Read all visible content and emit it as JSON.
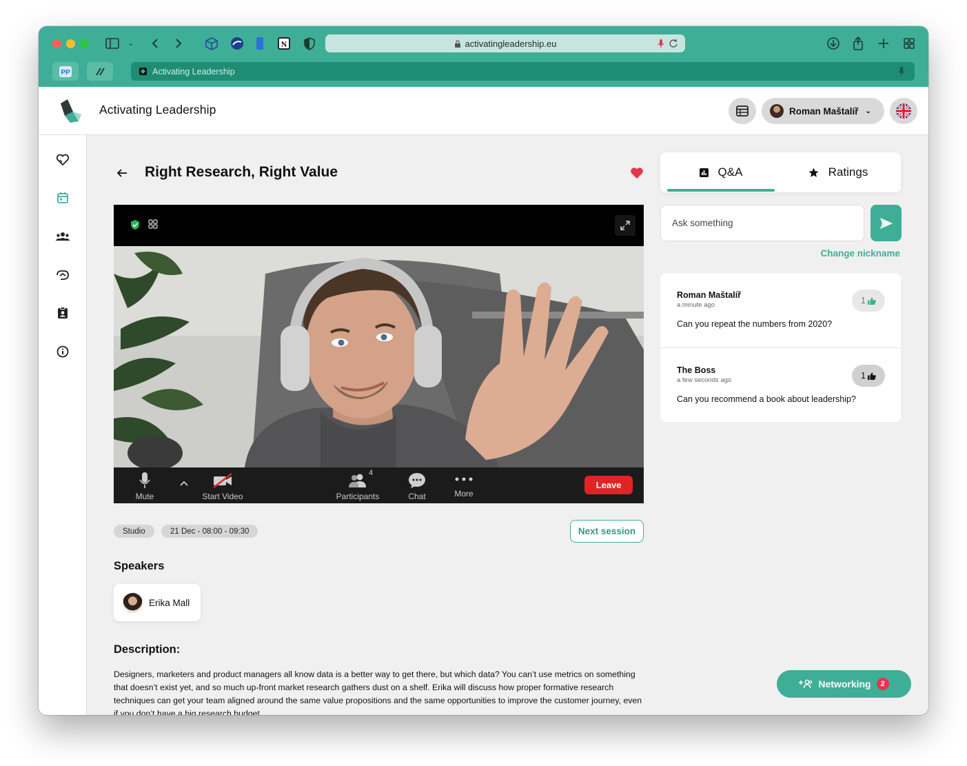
{
  "browser": {
    "url": "activatingleadership.eu",
    "tab_title": "Activating Leadership"
  },
  "header": {
    "app_title": "Activating Leadership",
    "user_name": "Roman Maštalíř"
  },
  "session": {
    "title": "Right Research, Right Value",
    "tags": [
      "Studio",
      "21 Dec - 08:00 - 09:30"
    ],
    "next_label": "Next session"
  },
  "video_controls": {
    "mute": "Mute",
    "start_video": "Start Video",
    "participants": "Participants",
    "participants_count": "4",
    "chat": "Chat",
    "more": "More",
    "leave": "Leave"
  },
  "speakers": {
    "heading": "Speakers",
    "items": [
      {
        "name": "Erika Mall"
      }
    ]
  },
  "description": {
    "heading": "Description:",
    "text": "Designers, marketers and product managers all know data is a better way to get there, but which data? You can’t use metrics on something that doesn’t exist yet, and so much up-front market research gathers dust on a shelf. Erika will discuss how proper formative research techniques can get your team aligned around the same value propositions and the same opportunities to improve the customer journey, even if you don’t have a big research budget."
  },
  "qa": {
    "tabs": [
      {
        "label": "Q&A"
      },
      {
        "label": "Ratings"
      }
    ],
    "ask_placeholder": "Ask something",
    "change_nickname": "Change nickname",
    "questions": [
      {
        "author": "Roman Maštalíř",
        "time": "a minute ago",
        "text": "Can you repeat the numbers from 2020?",
        "likes": "1"
      },
      {
        "author": "The Boss",
        "time": "a few seconds ago",
        "text": "Can you recommend a book about leadership?",
        "likes": "1"
      }
    ]
  },
  "networking": {
    "label": "Networking",
    "badge": "2"
  },
  "colors": {
    "accent": "#3fae96",
    "leave": "#e02424",
    "heart": "#e5354b",
    "badge": "#e5354b"
  }
}
